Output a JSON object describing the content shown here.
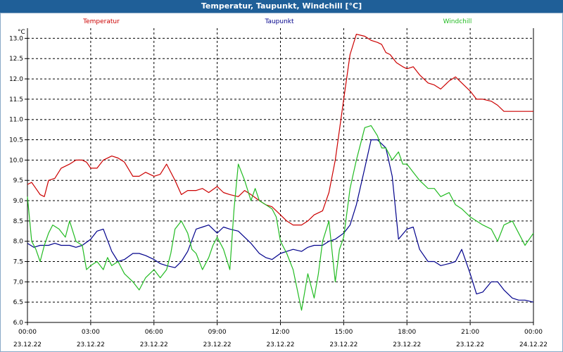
{
  "window": {
    "title": "Temperatur, Taupunkt, Windchill [°C]"
  },
  "chart_data": {
    "type": "line",
    "title": "Temperatur, Taupunkt, Windchill [°C]",
    "ylabel": "°C",
    "ylim": [
      6.0,
      13.25
    ],
    "grid": true,
    "legend_position": "top",
    "x_ticks": [
      "00:00",
      "03:00",
      "06:00",
      "09:00",
      "12:00",
      "15:00",
      "18:00",
      "21:00",
      "00:00"
    ],
    "x_dates": [
      "23.12.22",
      "23.12.22",
      "23.12.22",
      "23.12.22",
      "23.12.22",
      "23.12.22",
      "23.12.22",
      "23.12.22",
      "24.12.22"
    ],
    "y_ticks": [
      "6.0",
      "6.5",
      "7.0",
      "7.5",
      "8.0",
      "8.5",
      "9.0",
      "9.5",
      "10.0",
      "10.5",
      "11.0",
      "11.5",
      "12.0",
      "12.5",
      "13.0"
    ],
    "series": [
      {
        "name": "Temperatur",
        "color": "#cc0000",
        "x": [
          0,
          0.2,
          0.4,
          0.6,
          0.8,
          1.0,
          1.3,
          1.6,
          2.0,
          2.3,
          2.6,
          2.8,
          3.0,
          3.3,
          3.6,
          4.0,
          4.3,
          4.6,
          5.0,
          5.3,
          5.6,
          6.0,
          6.3,
          6.6,
          7.0,
          7.3,
          7.6,
          8.0,
          8.3,
          8.6,
          9.0,
          9.3,
          9.6,
          10.0,
          10.3,
          10.6,
          11.0,
          11.3,
          11.6,
          12.0,
          12.3,
          12.6,
          13.0,
          13.3,
          13.6,
          14.0,
          14.3,
          14.6,
          15.0,
          15.3,
          15.6,
          16.0,
          16.3,
          16.6,
          16.8,
          17.0,
          17.2,
          17.5,
          17.8,
          18.0,
          18.3,
          18.6,
          19.0,
          19.3,
          19.6,
          20.0,
          20.3,
          20.6,
          21.0,
          21.3,
          21.6,
          22.0,
          22.3,
          22.6,
          23.0,
          23.3,
          23.6,
          24.0
        ],
        "values": [
          9.4,
          9.45,
          9.3,
          9.15,
          9.1,
          9.5,
          9.55,
          9.8,
          9.9,
          10.0,
          10.0,
          9.95,
          9.8,
          9.8,
          10.0,
          10.1,
          10.05,
          9.95,
          9.6,
          9.6,
          9.7,
          9.6,
          9.65,
          9.9,
          9.5,
          9.15,
          9.25,
          9.25,
          9.3,
          9.2,
          9.35,
          9.2,
          9.15,
          9.1,
          9.25,
          9.15,
          9.0,
          8.9,
          8.85,
          8.65,
          8.5,
          8.4,
          8.4,
          8.5,
          8.65,
          8.75,
          9.2,
          10.0,
          11.5,
          12.6,
          13.1,
          13.05,
          12.95,
          12.9,
          12.85,
          12.65,
          12.6,
          12.4,
          12.3,
          12.25,
          12.3,
          12.1,
          11.9,
          11.85,
          11.75,
          11.95,
          12.05,
          11.9,
          11.7,
          11.5,
          11.5,
          11.45,
          11.35,
          11.2,
          11.2,
          11.2,
          11.2,
          11.2
        ]
      },
      {
        "name": "Taupunkt",
        "color": "#00008b",
        "x": [
          0,
          0.3,
          0.6,
          1.0,
          1.3,
          1.6,
          2.0,
          2.3,
          2.6,
          3.0,
          3.3,
          3.6,
          4.0,
          4.3,
          4.6,
          5.0,
          5.3,
          5.6,
          6.0,
          6.3,
          6.6,
          7.0,
          7.3,
          7.6,
          8.0,
          8.3,
          8.6,
          9.0,
          9.3,
          9.6,
          10.0,
          10.3,
          10.6,
          11.0,
          11.3,
          11.6,
          12.0,
          12.3,
          12.6,
          13.0,
          13.3,
          13.6,
          14.0,
          14.3,
          14.6,
          15.0,
          15.3,
          15.6,
          16.0,
          16.3,
          16.6,
          17.0,
          17.3,
          17.6,
          18.0,
          18.3,
          18.6,
          19.0,
          19.3,
          19.6,
          20.0,
          20.3,
          20.6,
          21.0,
          21.3,
          21.6,
          22.0,
          22.3,
          22.6,
          23.0,
          23.3,
          23.6,
          24.0
        ],
        "values": [
          7.95,
          7.85,
          7.9,
          7.9,
          7.95,
          7.9,
          7.9,
          7.85,
          7.9,
          8.05,
          8.25,
          8.3,
          7.75,
          7.5,
          7.55,
          7.7,
          7.7,
          7.65,
          7.55,
          7.45,
          7.4,
          7.35,
          7.5,
          7.75,
          8.3,
          8.35,
          8.4,
          8.2,
          8.35,
          8.3,
          8.25,
          8.1,
          7.95,
          7.7,
          7.6,
          7.55,
          7.7,
          7.75,
          7.8,
          7.75,
          7.85,
          7.9,
          7.9,
          8.0,
          8.05,
          8.2,
          8.4,
          8.9,
          9.8,
          10.5,
          10.5,
          10.3,
          9.6,
          8.05,
          8.3,
          8.35,
          7.8,
          7.5,
          7.5,
          7.4,
          7.45,
          7.5,
          7.8,
          7.2,
          6.7,
          6.75,
          7.0,
          7.0,
          6.8,
          6.6,
          6.55,
          6.55,
          6.5
        ]
      },
      {
        "name": "Windchill",
        "color": "#22bb22",
        "x": [
          0,
          0.2,
          0.4,
          0.6,
          0.8,
          1.0,
          1.2,
          1.5,
          1.8,
          2.0,
          2.3,
          2.6,
          2.8,
          3.0,
          3.3,
          3.6,
          3.8,
          4.0,
          4.3,
          4.6,
          5.0,
          5.3,
          5.6,
          5.8,
          6.0,
          6.3,
          6.6,
          6.8,
          7.0,
          7.3,
          7.6,
          7.8,
          8.0,
          8.3,
          8.6,
          8.8,
          9.0,
          9.3,
          9.6,
          9.8,
          10.0,
          10.3,
          10.6,
          10.8,
          11.0,
          11.3,
          11.6,
          11.8,
          12.0,
          12.3,
          12.6,
          12.8,
          13.0,
          13.3,
          13.6,
          13.8,
          14.0,
          14.3,
          14.6,
          14.8,
          15.0,
          15.3,
          15.6,
          16.0,
          16.3,
          16.6,
          16.8,
          17.0,
          17.3,
          17.6,
          17.8,
          18.0,
          18.3,
          18.6,
          19.0,
          19.3,
          19.6,
          20.0,
          20.3,
          20.6,
          21.0,
          21.3,
          21.6,
          22.0,
          22.3,
          22.6,
          23.0,
          23.3,
          23.6,
          24.0
        ],
        "values": [
          9.1,
          8.0,
          7.8,
          7.5,
          7.9,
          8.2,
          8.4,
          8.3,
          8.1,
          8.5,
          8.0,
          7.9,
          7.3,
          7.4,
          7.5,
          7.3,
          7.6,
          7.4,
          7.5,
          7.2,
          7.0,
          6.8,
          7.1,
          7.2,
          7.3,
          7.1,
          7.3,
          7.7,
          8.3,
          8.5,
          8.2,
          7.8,
          7.7,
          7.3,
          7.6,
          7.9,
          8.1,
          7.8,
          7.3,
          8.8,
          9.9,
          9.5,
          9.0,
          9.3,
          9.0,
          8.9,
          8.8,
          8.6,
          8.0,
          7.7,
          7.3,
          6.8,
          6.3,
          7.2,
          6.6,
          7.2,
          8.0,
          8.5,
          7.0,
          7.8,
          8.1,
          9.3,
          10.0,
          10.8,
          10.85,
          10.6,
          10.3,
          10.3,
          10.0,
          10.2,
          9.9,
          9.9,
          9.7,
          9.5,
          9.3,
          9.3,
          9.1,
          9.2,
          8.9,
          8.8,
          8.6,
          8.5,
          8.4,
          8.3,
          8.0,
          8.4,
          8.5,
          8.2,
          7.9,
          8.2
        ]
      }
    ]
  }
}
